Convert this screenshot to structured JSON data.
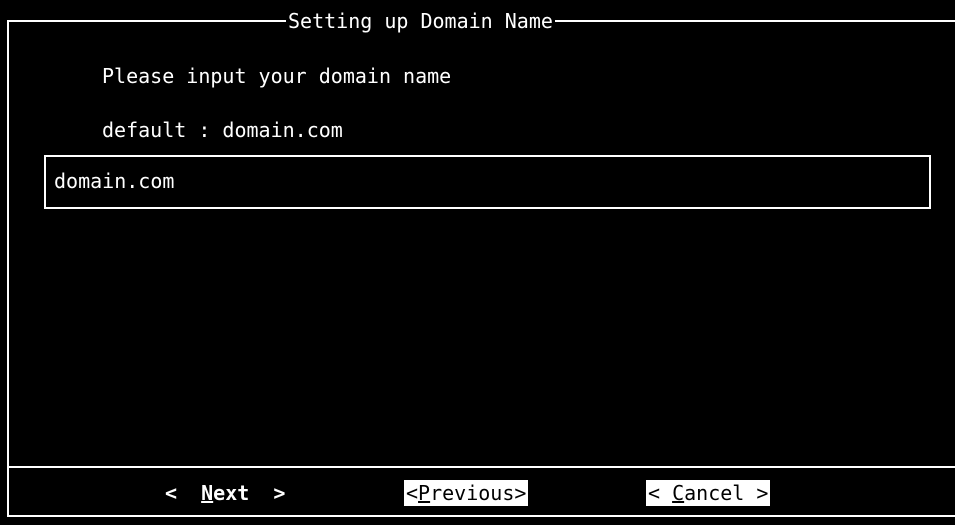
{
  "dialog": {
    "title": "Setting up Domain Name",
    "prompt": "Please input your domain name",
    "default_text": "default : domain.com"
  },
  "input": {
    "value": "domain.com"
  },
  "buttons": {
    "next": {
      "left": "<  ",
      "hotkey": "N",
      "rest": "ext  >"
    },
    "previous": {
      "left": "<",
      "hotkey": "P",
      "rest": "revious>"
    },
    "cancel": {
      "left": "< ",
      "hotkey": "C",
      "rest": "ancel >"
    }
  }
}
